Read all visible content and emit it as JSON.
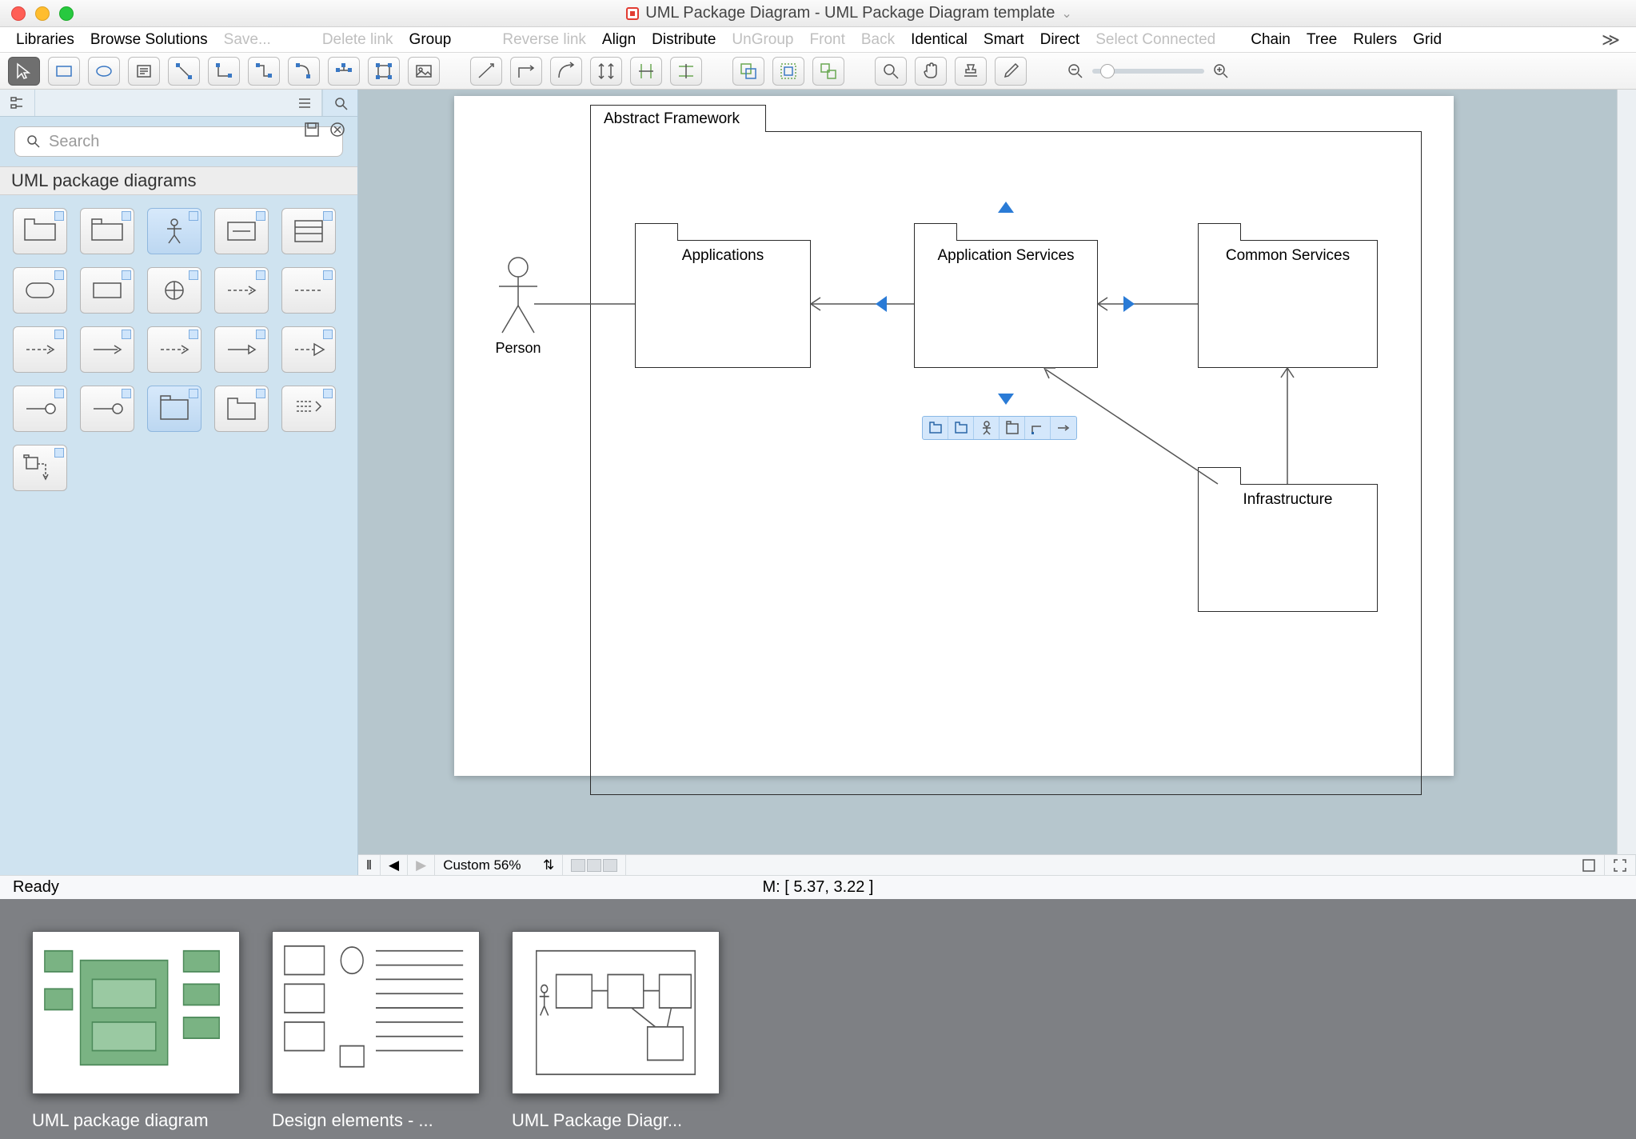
{
  "title": "UML Package Diagram - UML Package Diagram template",
  "menus": {
    "libraries": "Libraries",
    "browse": "Browse Solutions",
    "save": "Save...",
    "deletelink": "Delete link",
    "group": "Group",
    "reverselink": "Reverse link",
    "align": "Align",
    "distribute": "Distribute",
    "ungroup": "UnGroup",
    "front": "Front",
    "back": "Back",
    "identical": "Identical",
    "smart": "Smart",
    "direct": "Direct",
    "selectconnected": "Select Connected",
    "chain": "Chain",
    "tree": "Tree",
    "rulers": "Rulers",
    "grid": "Grid"
  },
  "search": {
    "placeholder": "Search"
  },
  "lib": {
    "title": "UML package diagrams"
  },
  "diagram": {
    "frame": "Abstract Framework",
    "pkg_apps": "Applications",
    "pkg_appserv": "Application Services",
    "pkg_common": "Common Services",
    "pkg_infra": "Infrastructure",
    "actor": "Person"
  },
  "canvas": {
    "zoom_label": "Custom 56%"
  },
  "status": {
    "ready": "Ready",
    "coords": "M: [ 5.37, 3.22 ]"
  },
  "thumbs": {
    "a": "UML package diagram",
    "b": "Design elements - ...",
    "c": "UML Package Diagr..."
  }
}
